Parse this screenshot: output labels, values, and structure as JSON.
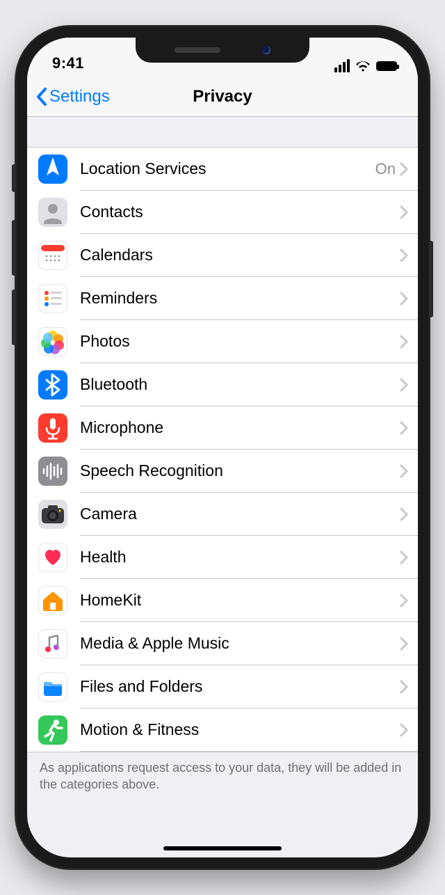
{
  "status": {
    "time": "9:41"
  },
  "nav": {
    "back": "Settings",
    "title": "Privacy"
  },
  "rows": [
    {
      "icon": "location",
      "label": "Location Services",
      "value": "On"
    },
    {
      "icon": "contacts",
      "label": "Contacts",
      "value": ""
    },
    {
      "icon": "calendars",
      "label": "Calendars",
      "value": ""
    },
    {
      "icon": "reminders",
      "label": "Reminders",
      "value": ""
    },
    {
      "icon": "photos",
      "label": "Photos",
      "value": ""
    },
    {
      "icon": "bluetooth",
      "label": "Bluetooth",
      "value": ""
    },
    {
      "icon": "microphone",
      "label": "Microphone",
      "value": ""
    },
    {
      "icon": "speech",
      "label": "Speech Recognition",
      "value": ""
    },
    {
      "icon": "camera",
      "label": "Camera",
      "value": ""
    },
    {
      "icon": "health",
      "label": "Health",
      "value": ""
    },
    {
      "icon": "homekit",
      "label": "HomeKit",
      "value": ""
    },
    {
      "icon": "music",
      "label": "Media & Apple Music",
      "value": ""
    },
    {
      "icon": "files",
      "label": "Files and Folders",
      "value": ""
    },
    {
      "icon": "motion",
      "label": "Motion & Fitness",
      "value": ""
    }
  ],
  "footer": "As applications request access to your data, they will be added in the categories above."
}
